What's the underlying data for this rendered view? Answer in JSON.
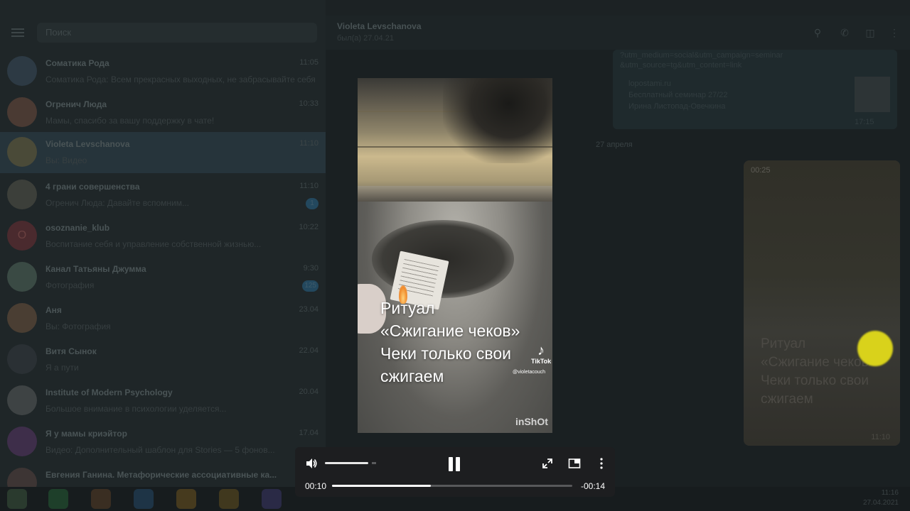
{
  "sidebar": {
    "search_placeholder": "Поиск",
    "chats": [
      {
        "name": "Соматика Рода",
        "time": "11:05",
        "msg": "Соматика Рода: Всем прекрасных выходных, не забрасывайте себя!"
      },
      {
        "name": "Огренич Люда",
        "time": "10:33",
        "msg": "Мамы, спасибо за вашу поддержку в чате!"
      },
      {
        "name": "Violeta Levschanova",
        "time": "11:10",
        "msg": "Вы: Видео"
      },
      {
        "name": "4 грани совершенства",
        "time": "11:10",
        "msg": "Огренич Люда: Давайте вспомним...",
        "badge": "1"
      },
      {
        "name": "osoznanie_klub",
        "time": "10:22",
        "msg": "Воспитание себя и управление собственной жизнью...",
        "avatar_letter": "O"
      },
      {
        "name": "Канал Татьяны Джумма",
        "time": "9:30",
        "msg": "Фотография",
        "badge": "125"
      },
      {
        "name": "Аня",
        "time": "23.04",
        "msg": "Вы: Фотография"
      },
      {
        "name": "Витя Сынок",
        "time": "22.04",
        "msg": "Я а пути"
      },
      {
        "name": "Institute of Modern Psychology",
        "time": "20.04",
        "msg": "Большое внимание в психологии уделяется..."
      },
      {
        "name": "Я у мамы криэйтор",
        "time": "17.04",
        "msg": "Видео: Дополнительный шаблон для Stories — 5 фонов..."
      },
      {
        "name": "Евгения Ганина. Метафорические ассоциативные ка...",
        "time": "",
        "msg": ""
      }
    ]
  },
  "header": {
    "name": "Violeta Levschanova",
    "status": "был(а) 27.04.21"
  },
  "messages": {
    "link_card": {
      "url_line1": "?utm_medium=social&utm_campaign=seminar",
      "url_line2": "&utm_source=tg&utm_content=link",
      "site": "lopostami.ru",
      "title": "Бесплатный семинар 27/22",
      "subtitle": "Ирина Листопад-Овечкина",
      "time": "17:15"
    },
    "date_separator": "27 апреля",
    "video_bubble": {
      "duration": "00:25",
      "caption_lines": [
        "Ритуал",
        "«Сжигание чеков»",
        "Чеки только свои",
        "сжигаем"
      ],
      "time": "11:10"
    }
  },
  "player": {
    "caption_lines": [
      "Ритуал",
      "«Сжигание чеков»",
      "Чеки только свои",
      "сжигаем"
    ],
    "tiktok_label": "TikTok",
    "tiktok_handle": "@violetacouch",
    "watermark": "inShOt",
    "current_time": "00:10",
    "remaining_time": "-00:14",
    "progress": 0.41,
    "volume": 0.85
  },
  "taskbar": {
    "time": "11:16",
    "date": "27.04.2021"
  }
}
